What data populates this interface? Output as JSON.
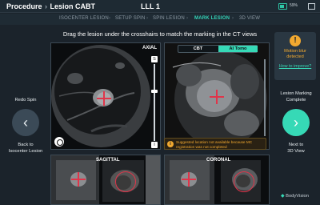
{
  "header": {
    "breadcrumb": [
      "Procedure",
      "Lesion CABT"
    ],
    "room": "LLL 1",
    "battery_pct": "59%"
  },
  "steps": [
    {
      "label": "ISOCENTER LESION",
      "active": false
    },
    {
      "label": "SETUP SPIN",
      "active": false
    },
    {
      "label": "SPIN LESION",
      "active": false
    },
    {
      "label": "MARK LESION",
      "active": true
    },
    {
      "label": "3D VIEW",
      "active": false
    }
  ],
  "instruction": "Drag the lesion under the crosshairs to match the marking in the CT views",
  "left_panel": {
    "top_label": "Redo Spin",
    "bottom_label_line1": "Back to",
    "bottom_label_line2": "Isocenter Lesion",
    "button_icon": "chevron-left-icon"
  },
  "right_panel": {
    "top_label_line1": "Lesion Marking",
    "top_label_line2": "Complete",
    "bottom_label_line1": "Next to",
    "bottom_label_line2": "3D View",
    "button_icon": "chevron-right-icon"
  },
  "warning": {
    "icon": "exclamation-icon",
    "text_line1": "Motion blur",
    "text_line2": "detected",
    "link": "How to improve?"
  },
  "viewers": {
    "axial": {
      "label": "AXIAL",
      "slider_top": "S",
      "slider_bottom": "I"
    },
    "ct_toggle": {
      "option1": "CBT",
      "option2": "AI Tomo",
      "selected": "AI Tomo"
    },
    "sagittal": {
      "label": "SAGITTAL"
    },
    "coronal": {
      "label": "CORONAL"
    }
  },
  "notice": {
    "icon": "info-icon",
    "text": "Suggested location not available because MC registration was not completed"
  },
  "brand": "BodyVision",
  "colors": {
    "accent": "#36d9b6",
    "warning": "#f2a930",
    "crosshair": "#e0354a"
  }
}
